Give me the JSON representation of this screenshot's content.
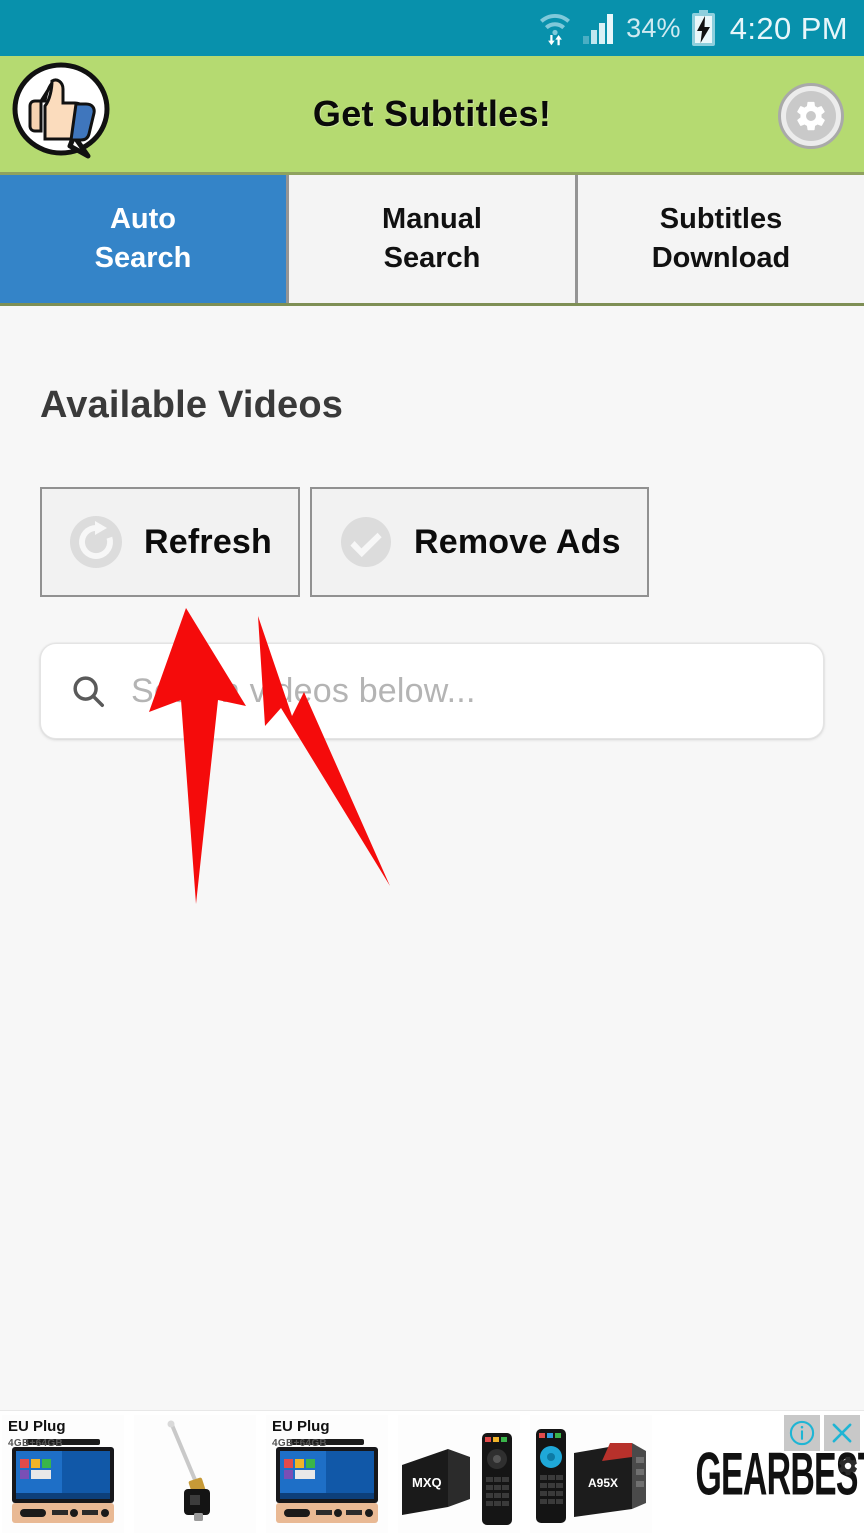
{
  "status_bar": {
    "wifi_icon": "wifi-transfer-icon",
    "signal_icon": "cellular-signal-icon",
    "battery_percent": "34%",
    "battery_icon": "battery-charging-icon",
    "time": "4:20 PM",
    "background_color": "#0891ac",
    "text_color": "#cfeaf1"
  },
  "app_bar": {
    "title": "Get Subtitles!",
    "logo_icon": "thumbs-up-speech-bubble-icon",
    "settings_icon": "gear-icon",
    "background_color": "#b5da71"
  },
  "tabs": [
    {
      "line1": "Auto",
      "line2": "Search",
      "active": true
    },
    {
      "line1": "Manual",
      "line2": "Search",
      "active": false
    },
    {
      "line1": "Subtitles",
      "line2": "Download",
      "active": false
    }
  ],
  "tab_active_color": "#3484c8",
  "main": {
    "section_title": "Available Videos",
    "buttons": [
      {
        "label": "Refresh",
        "icon": "refresh-icon"
      },
      {
        "label": "Remove Ads",
        "icon": "check-circle-icon"
      }
    ],
    "search": {
      "placeholder": "Search videos below...",
      "value": "",
      "icon": "search-icon"
    }
  },
  "annotations": {
    "arrow_color": "#f50b0b",
    "arrows": [
      {
        "name": "arrow-pointing-refresh-button"
      },
      {
        "name": "arrow-pointing-remove-ads-button"
      }
    ]
  },
  "ad_banner": {
    "brand": "GEARBEST",
    "brand_gear_icon": "gear-icon",
    "info_icon": "info-icon",
    "close_icon": "close-icon",
    "products": [
      {
        "tag": "EU Plug",
        "sub": "4GB+64GB",
        "alt": "mini-pc-tablet"
      },
      {
        "tag": "",
        "sub": "",
        "alt": "tv-antenna-dongle"
      },
      {
        "tag": "EU Plug",
        "sub": "4GB+64GB",
        "alt": "mini-pc-tablet"
      },
      {
        "tag": "",
        "sub": "",
        "alt": "mxq-tv-box-remote"
      },
      {
        "tag": "",
        "sub": "",
        "alt": "a95x-tv-box-remote"
      }
    ]
  }
}
